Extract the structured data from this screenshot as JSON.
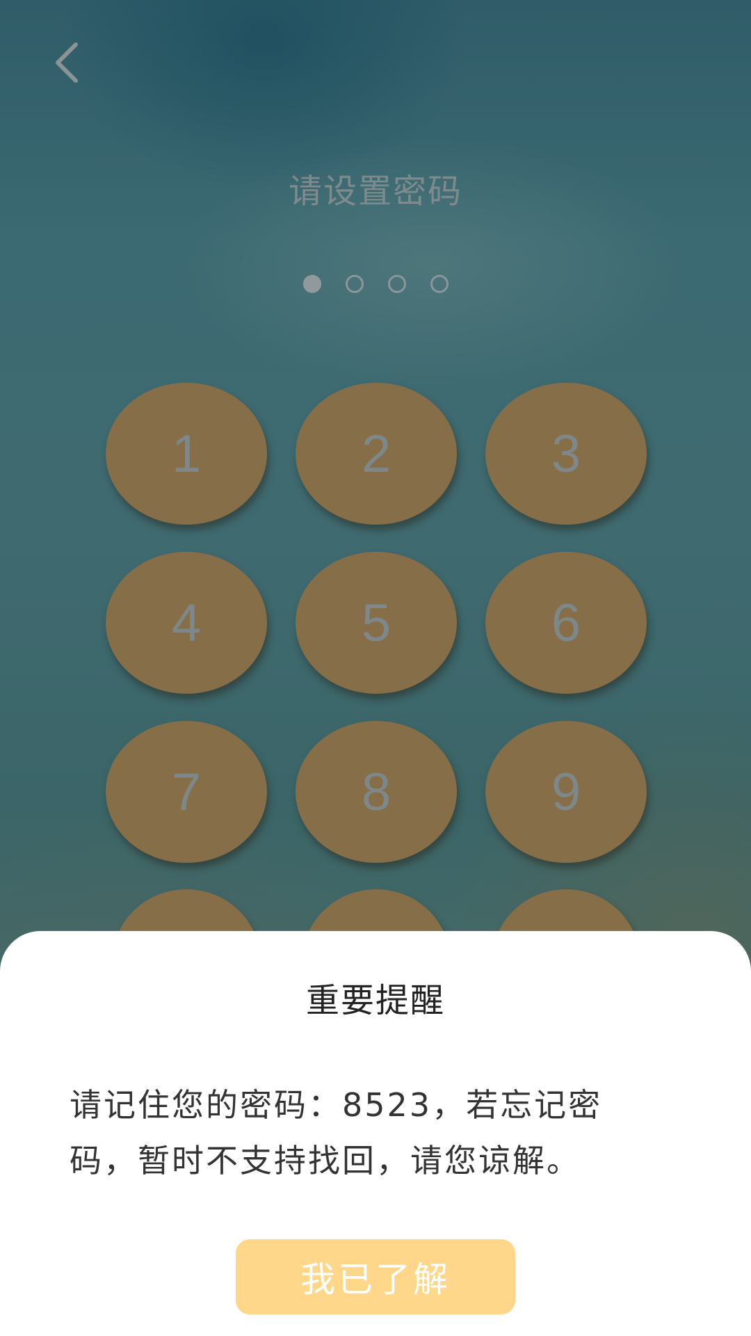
{
  "header": {
    "back_icon": "chevron-left-icon",
    "title": "请设置密码"
  },
  "pin_indicator": {
    "length": 4,
    "entered": 1
  },
  "keypad": {
    "keys": [
      "1",
      "2",
      "3",
      "4",
      "5",
      "6",
      "7",
      "8",
      "9"
    ],
    "key_color": "#856e48"
  },
  "dialog": {
    "title": "重要提醒",
    "message_line1": "请记住您的密码：8523，若忘记密",
    "message_line2": "码，暂时不支持找回，请您谅解。",
    "confirm_label": "我已了解",
    "confirm_color": "#fed78a"
  }
}
